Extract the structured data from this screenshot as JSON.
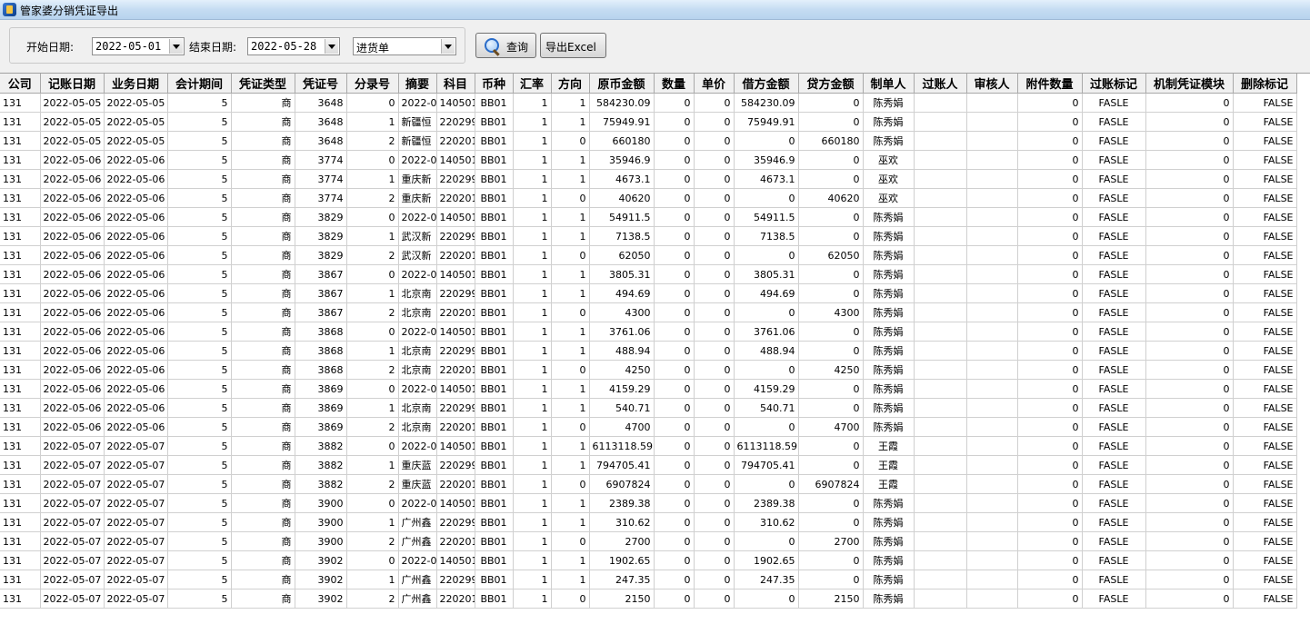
{
  "window": {
    "title": "管家婆分销凭证导出",
    "icon": "app-icon"
  },
  "toolbar": {
    "start_label": "开始日期:",
    "start_date": "2022-05-01",
    "end_label": "结束日期:",
    "end_date": "2022-05-28",
    "doc_type": "进货单",
    "query_label": "查询",
    "export_label": "导出Excel"
  },
  "grid": {
    "columns": [
      "公司",
      "记账日期",
      "业务日期",
      "会计期间",
      "凭证类型",
      "凭证号",
      "分录号",
      "摘要",
      "科目",
      "币种",
      "汇率",
      "方向",
      "原币金额",
      "数量",
      "单价",
      "借方金额",
      "贷方金额",
      "制单人",
      "过账人",
      "审核人",
      "附件数量",
      "过账标记",
      "机制凭证模块",
      "删除标记"
    ],
    "rows": [
      [
        "131",
        "2022-05-05",
        "2022-05-05",
        "5",
        "商",
        "3648",
        "0",
        "2022-0",
        "140501",
        "BB01",
        "1",
        "1",
        "584230.09",
        "0",
        "0",
        "584230.09",
        "0",
        "陈秀娟",
        "",
        "",
        "0",
        "FASLE",
        "0",
        "FALSE"
      ],
      [
        "131",
        "2022-05-05",
        "2022-05-05",
        "5",
        "商",
        "3648",
        "1",
        "新疆恒",
        "220299",
        "BB01",
        "1",
        "1",
        "75949.91",
        "0",
        "0",
        "75949.91",
        "0",
        "陈秀娟",
        "",
        "",
        "0",
        "FASLE",
        "0",
        "FALSE"
      ],
      [
        "131",
        "2022-05-05",
        "2022-05-05",
        "5",
        "商",
        "3648",
        "2",
        "新疆恒",
        "220201",
        "BB01",
        "1",
        "0",
        "660180",
        "0",
        "0",
        "0",
        "660180",
        "陈秀娟",
        "",
        "",
        "0",
        "FASLE",
        "0",
        "FALSE"
      ],
      [
        "131",
        "2022-05-06",
        "2022-05-06",
        "5",
        "商",
        "3774",
        "0",
        "2022-0",
        "140501",
        "BB01",
        "1",
        "1",
        "35946.9",
        "0",
        "0",
        "35946.9",
        "0",
        "巫欢",
        "",
        "",
        "0",
        "FASLE",
        "0",
        "FALSE"
      ],
      [
        "131",
        "2022-05-06",
        "2022-05-06",
        "5",
        "商",
        "3774",
        "1",
        "重庆新",
        "220299",
        "BB01",
        "1",
        "1",
        "4673.1",
        "0",
        "0",
        "4673.1",
        "0",
        "巫欢",
        "",
        "",
        "0",
        "FASLE",
        "0",
        "FALSE"
      ],
      [
        "131",
        "2022-05-06",
        "2022-05-06",
        "5",
        "商",
        "3774",
        "2",
        "重庆新",
        "220201",
        "BB01",
        "1",
        "0",
        "40620",
        "0",
        "0",
        "0",
        "40620",
        "巫欢",
        "",
        "",
        "0",
        "FASLE",
        "0",
        "FALSE"
      ],
      [
        "131",
        "2022-05-06",
        "2022-05-06",
        "5",
        "商",
        "3829",
        "0",
        "2022-0",
        "140501",
        "BB01",
        "1",
        "1",
        "54911.5",
        "0",
        "0",
        "54911.5",
        "0",
        "陈秀娟",
        "",
        "",
        "0",
        "FASLE",
        "0",
        "FALSE"
      ],
      [
        "131",
        "2022-05-06",
        "2022-05-06",
        "5",
        "商",
        "3829",
        "1",
        "武汉新",
        "220299",
        "BB01",
        "1",
        "1",
        "7138.5",
        "0",
        "0",
        "7138.5",
        "0",
        "陈秀娟",
        "",
        "",
        "0",
        "FASLE",
        "0",
        "FALSE"
      ],
      [
        "131",
        "2022-05-06",
        "2022-05-06",
        "5",
        "商",
        "3829",
        "2",
        "武汉新",
        "220201",
        "BB01",
        "1",
        "0",
        "62050",
        "0",
        "0",
        "0",
        "62050",
        "陈秀娟",
        "",
        "",
        "0",
        "FASLE",
        "0",
        "FALSE"
      ],
      [
        "131",
        "2022-05-06",
        "2022-05-06",
        "5",
        "商",
        "3867",
        "0",
        "2022-0",
        "140501",
        "BB01",
        "1",
        "1",
        "3805.31",
        "0",
        "0",
        "3805.31",
        "0",
        "陈秀娟",
        "",
        "",
        "0",
        "FASLE",
        "0",
        "FALSE"
      ],
      [
        "131",
        "2022-05-06",
        "2022-05-06",
        "5",
        "商",
        "3867",
        "1",
        "北京南",
        "220299",
        "BB01",
        "1",
        "1",
        "494.69",
        "0",
        "0",
        "494.69",
        "0",
        "陈秀娟",
        "",
        "",
        "0",
        "FASLE",
        "0",
        "FALSE"
      ],
      [
        "131",
        "2022-05-06",
        "2022-05-06",
        "5",
        "商",
        "3867",
        "2",
        "北京南",
        "220201",
        "BB01",
        "1",
        "0",
        "4300",
        "0",
        "0",
        "0",
        "4300",
        "陈秀娟",
        "",
        "",
        "0",
        "FASLE",
        "0",
        "FALSE"
      ],
      [
        "131",
        "2022-05-06",
        "2022-05-06",
        "5",
        "商",
        "3868",
        "0",
        "2022-0",
        "140501",
        "BB01",
        "1",
        "1",
        "3761.06",
        "0",
        "0",
        "3761.06",
        "0",
        "陈秀娟",
        "",
        "",
        "0",
        "FASLE",
        "0",
        "FALSE"
      ],
      [
        "131",
        "2022-05-06",
        "2022-05-06",
        "5",
        "商",
        "3868",
        "1",
        "北京南",
        "220299",
        "BB01",
        "1",
        "1",
        "488.94",
        "0",
        "0",
        "488.94",
        "0",
        "陈秀娟",
        "",
        "",
        "0",
        "FASLE",
        "0",
        "FALSE"
      ],
      [
        "131",
        "2022-05-06",
        "2022-05-06",
        "5",
        "商",
        "3868",
        "2",
        "北京南",
        "220201",
        "BB01",
        "1",
        "0",
        "4250",
        "0",
        "0",
        "0",
        "4250",
        "陈秀娟",
        "",
        "",
        "0",
        "FASLE",
        "0",
        "FALSE"
      ],
      [
        "131",
        "2022-05-06",
        "2022-05-06",
        "5",
        "商",
        "3869",
        "0",
        "2022-0",
        "140501",
        "BB01",
        "1",
        "1",
        "4159.29",
        "0",
        "0",
        "4159.29",
        "0",
        "陈秀娟",
        "",
        "",
        "0",
        "FASLE",
        "0",
        "FALSE"
      ],
      [
        "131",
        "2022-05-06",
        "2022-05-06",
        "5",
        "商",
        "3869",
        "1",
        "北京南",
        "220299",
        "BB01",
        "1",
        "1",
        "540.71",
        "0",
        "0",
        "540.71",
        "0",
        "陈秀娟",
        "",
        "",
        "0",
        "FASLE",
        "0",
        "FALSE"
      ],
      [
        "131",
        "2022-05-06",
        "2022-05-06",
        "5",
        "商",
        "3869",
        "2",
        "北京南",
        "220201",
        "BB01",
        "1",
        "0",
        "4700",
        "0",
        "0",
        "0",
        "4700",
        "陈秀娟",
        "",
        "",
        "0",
        "FASLE",
        "0",
        "FALSE"
      ],
      [
        "131",
        "2022-05-07",
        "2022-05-07",
        "5",
        "商",
        "3882",
        "0",
        "2022-0",
        "140501",
        "BB01",
        "1",
        "1",
        "6113118.59",
        "0",
        "0",
        "6113118.59",
        "0",
        "王霞",
        "",
        "",
        "0",
        "FASLE",
        "0",
        "FALSE"
      ],
      [
        "131",
        "2022-05-07",
        "2022-05-07",
        "5",
        "商",
        "3882",
        "1",
        "重庆蓝",
        "220299",
        "BB01",
        "1",
        "1",
        "794705.41",
        "0",
        "0",
        "794705.41",
        "0",
        "王霞",
        "",
        "",
        "0",
        "FASLE",
        "0",
        "FALSE"
      ],
      [
        "131",
        "2022-05-07",
        "2022-05-07",
        "5",
        "商",
        "3882",
        "2",
        "重庆蓝",
        "220201",
        "BB01",
        "1",
        "0",
        "6907824",
        "0",
        "0",
        "0",
        "6907824",
        "王霞",
        "",
        "",
        "0",
        "FASLE",
        "0",
        "FALSE"
      ],
      [
        "131",
        "2022-05-07",
        "2022-05-07",
        "5",
        "商",
        "3900",
        "0",
        "2022-0",
        "140501",
        "BB01",
        "1",
        "1",
        "2389.38",
        "0",
        "0",
        "2389.38",
        "0",
        "陈秀娟",
        "",
        "",
        "0",
        "FASLE",
        "0",
        "FALSE"
      ],
      [
        "131",
        "2022-05-07",
        "2022-05-07",
        "5",
        "商",
        "3900",
        "1",
        "广州鑫",
        "220299",
        "BB01",
        "1",
        "1",
        "310.62",
        "0",
        "0",
        "310.62",
        "0",
        "陈秀娟",
        "",
        "",
        "0",
        "FASLE",
        "0",
        "FALSE"
      ],
      [
        "131",
        "2022-05-07",
        "2022-05-07",
        "5",
        "商",
        "3900",
        "2",
        "广州鑫",
        "220201",
        "BB01",
        "1",
        "0",
        "2700",
        "0",
        "0",
        "0",
        "2700",
        "陈秀娟",
        "",
        "",
        "0",
        "FASLE",
        "0",
        "FALSE"
      ],
      [
        "131",
        "2022-05-07",
        "2022-05-07",
        "5",
        "商",
        "3902",
        "0",
        "2022-0",
        "140501",
        "BB01",
        "1",
        "1",
        "1902.65",
        "0",
        "0",
        "1902.65",
        "0",
        "陈秀娟",
        "",
        "",
        "0",
        "FASLE",
        "0",
        "FALSE"
      ],
      [
        "131",
        "2022-05-07",
        "2022-05-07",
        "5",
        "商",
        "3902",
        "1",
        "广州鑫",
        "220299",
        "BB01",
        "1",
        "1",
        "247.35",
        "0",
        "0",
        "247.35",
        "0",
        "陈秀娟",
        "",
        "",
        "0",
        "FASLE",
        "0",
        "FALSE"
      ],
      [
        "131",
        "2022-05-07",
        "2022-05-07",
        "5",
        "商",
        "3902",
        "2",
        "广州鑫",
        "220201",
        "BB01",
        "1",
        "0",
        "2150",
        "0",
        "0",
        "0",
        "2150",
        "陈秀娟",
        "",
        "",
        "0",
        "FASLE",
        "0",
        "FALSE"
      ]
    ]
  }
}
